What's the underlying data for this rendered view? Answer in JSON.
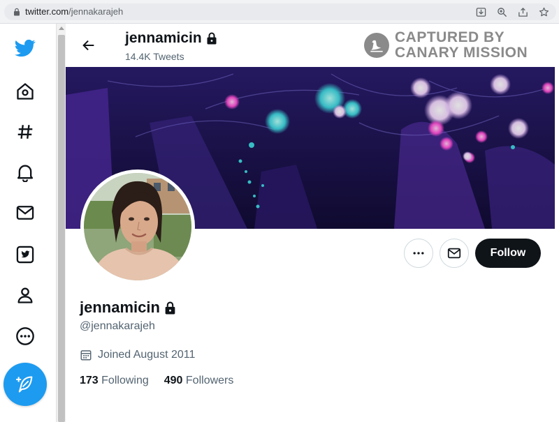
{
  "browser": {
    "url_host": "twitter.com",
    "url_path": "/jennakarajeh",
    "icons": [
      "download-icon",
      "zoom-icon",
      "share-icon",
      "bookmark-star-icon"
    ]
  },
  "nav": {
    "icons": [
      "twitter-logo-icon",
      "home-icon",
      "explore-hashtag-icon",
      "notifications-bell-icon",
      "messages-envelope-icon",
      "twitter-blue-icon",
      "profile-icon",
      "more-icon",
      "compose-tweet-icon"
    ],
    "brand_color": "#1d9bf0"
  },
  "header": {
    "name": "jennamicin",
    "tweets": "14.4K Tweets"
  },
  "watermark": {
    "line1": "CAPTURED BY",
    "line2": "CANARY MISSION"
  },
  "actions": {
    "follow_label": "Follow",
    "more_icon": "more-horizontal-icon",
    "message_icon": "envelope-icon"
  },
  "profile": {
    "name": "jennamicin",
    "handle": "@jennakarajeh",
    "joined": "Joined August 2011",
    "following_count": "173",
    "following_label": "Following",
    "followers_count": "490",
    "followers_label": "Followers"
  }
}
